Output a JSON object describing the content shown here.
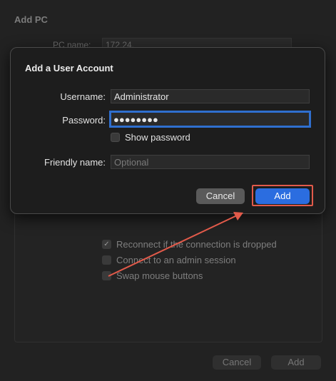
{
  "background_window": {
    "title": "Add PC",
    "pc_name_label": "PC name:",
    "pc_name_value": "172.24.",
    "options": [
      {
        "label": "Reconnect if the connection is dropped",
        "checked": true
      },
      {
        "label": "Connect to an admin session",
        "checked": false
      },
      {
        "label": "Swap mouse buttons",
        "checked": false
      }
    ],
    "cancel_label": "Cancel",
    "add_label": "Add"
  },
  "dialog": {
    "title": "Add a User Account",
    "username_label": "Username:",
    "username_value": "Administrator",
    "password_label": "Password:",
    "password_value": "●●●●●●●●",
    "show_password_label": "Show password",
    "friendly_name_label": "Friendly name:",
    "friendly_name_placeholder": "Optional",
    "cancel_label": "Cancel",
    "add_label": "Add"
  },
  "colors": {
    "accent": "#2b6de0",
    "annotation": "#e25a4a"
  }
}
